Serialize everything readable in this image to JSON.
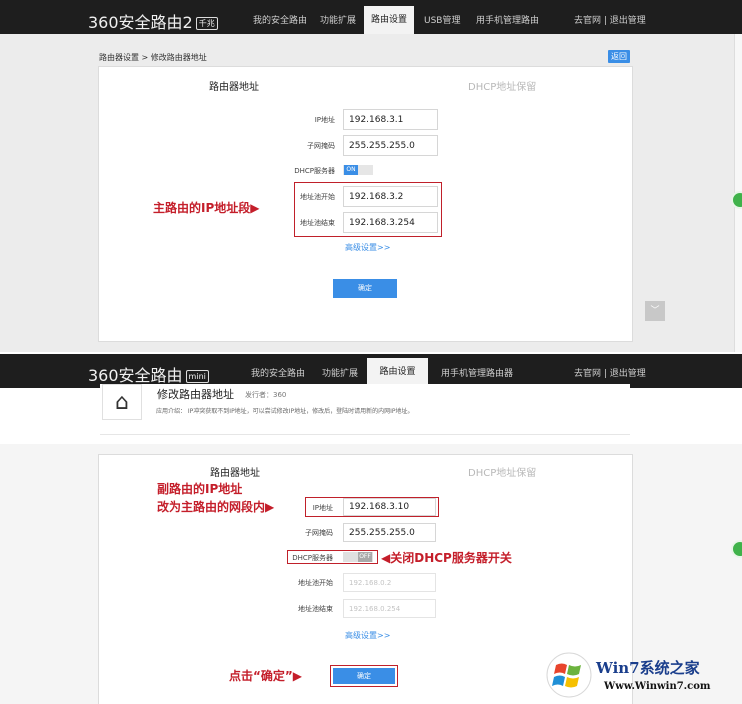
{
  "panel1": {
    "logo": "360安全路由2",
    "logo_badge": "千兆",
    "nav": [
      "我的安全路由",
      "功能扩展",
      "路由设置",
      "USB管理",
      "用手机管理路由"
    ],
    "nav_right": "去官网 | 退出管理",
    "breadcrumb": "路由器设置 > 修改路由器地址",
    "back": "返回",
    "tab_active": "路由器地址",
    "tab_inactive": "DHCP地址保留",
    "ip_label": "IP地址",
    "ip_value": "192.168.3.1",
    "mask_label": "子网掩码",
    "mask_value": "255.255.255.0",
    "dhcp_label": "DHCP服务器",
    "dhcp_state": "ON",
    "pool_start_label": "地址池开始",
    "pool_start_value": "192.168.3.2",
    "pool_end_label": "地址池结束",
    "pool_end_value": "192.168.3.254",
    "advanced": "高级设置>>",
    "ok": "确定",
    "annotation": "主路由的IP地址段▶",
    "scroll_glyph": "﹀"
  },
  "panel2": {
    "logo": "360安全路由",
    "logo_badge": "mini",
    "nav": [
      "我的安全路由",
      "功能扩展",
      "路由设置",
      "用手机管理路由器"
    ],
    "nav_right": "去官网 | 退出管理",
    "page_title": "修改路由器地址",
    "publisher": "发行者：360",
    "desc": "应用介绍：   IP冲突获取不到IP地址，可以尝试修改IP地址，修改后，登陆时请用新的内网IP地址。",
    "tab_active": "路由器地址",
    "tab_inactive": "DHCP地址保留",
    "ip_label": "IP地址",
    "ip_value": "192.168.3.10",
    "mask_label": "子网掩码",
    "mask_value": "255.255.255.0",
    "dhcp_label": "DHCP服务器",
    "dhcp_state": "OFF",
    "pool_start_label": "地址池开始",
    "pool_start_value": "192.168.0.2",
    "pool_end_label": "地址池结束",
    "pool_end_value": "192.168.0.254",
    "advanced": "高级设置>>",
    "ok": "确定",
    "annotation_line1": "副路由的IP地址",
    "annotation_line2": "改为主路由的网段内▶",
    "annotation_dhcp": "◀关闭DHCP服务器开关",
    "annotation_ok": "点击“确定”▶"
  },
  "watermark": {
    "title": "Win7系统之家",
    "url": "Www.Winwin7.com"
  },
  "colors": {
    "topbar": "#1e1e1e",
    "accent": "#3a8ee6",
    "annotation_red": "#c41e2a"
  }
}
